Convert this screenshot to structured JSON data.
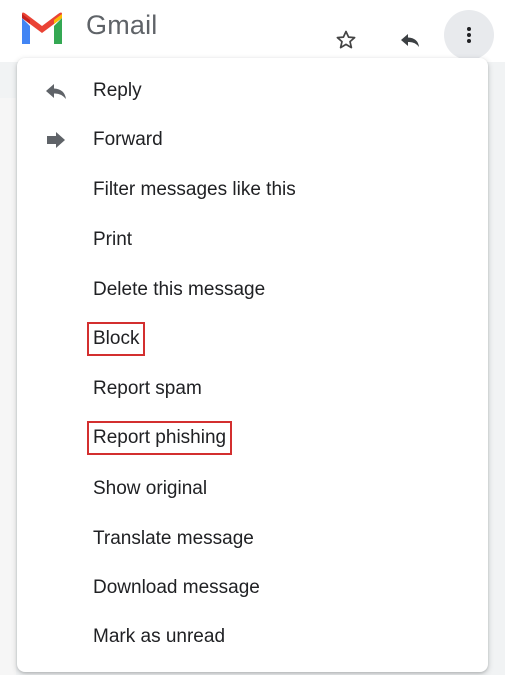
{
  "header": {
    "brand": "Gmail",
    "icons": {
      "logo": "gmail-logo",
      "star": "star-outline-icon",
      "reply": "reply-icon",
      "more": "more-vertical-icon"
    }
  },
  "menu": {
    "items": [
      {
        "label": "Reply",
        "icon": "reply-icon"
      },
      {
        "label": "Forward",
        "icon": "forward-icon"
      },
      {
        "label": "Filter messages like this"
      },
      {
        "label": "Print"
      },
      {
        "label": "Delete this message"
      },
      {
        "label": "Block",
        "highlighted": true
      },
      {
        "label": "Report spam"
      },
      {
        "label": "Report phishing",
        "highlighted": true
      },
      {
        "label": "Show original"
      },
      {
        "label": "Translate message"
      },
      {
        "label": "Download message"
      },
      {
        "label": "Mark as unread"
      }
    ]
  },
  "colors": {
    "highlight_box": "#d32f2f",
    "text": "#202124",
    "icon": "#5f6368"
  }
}
